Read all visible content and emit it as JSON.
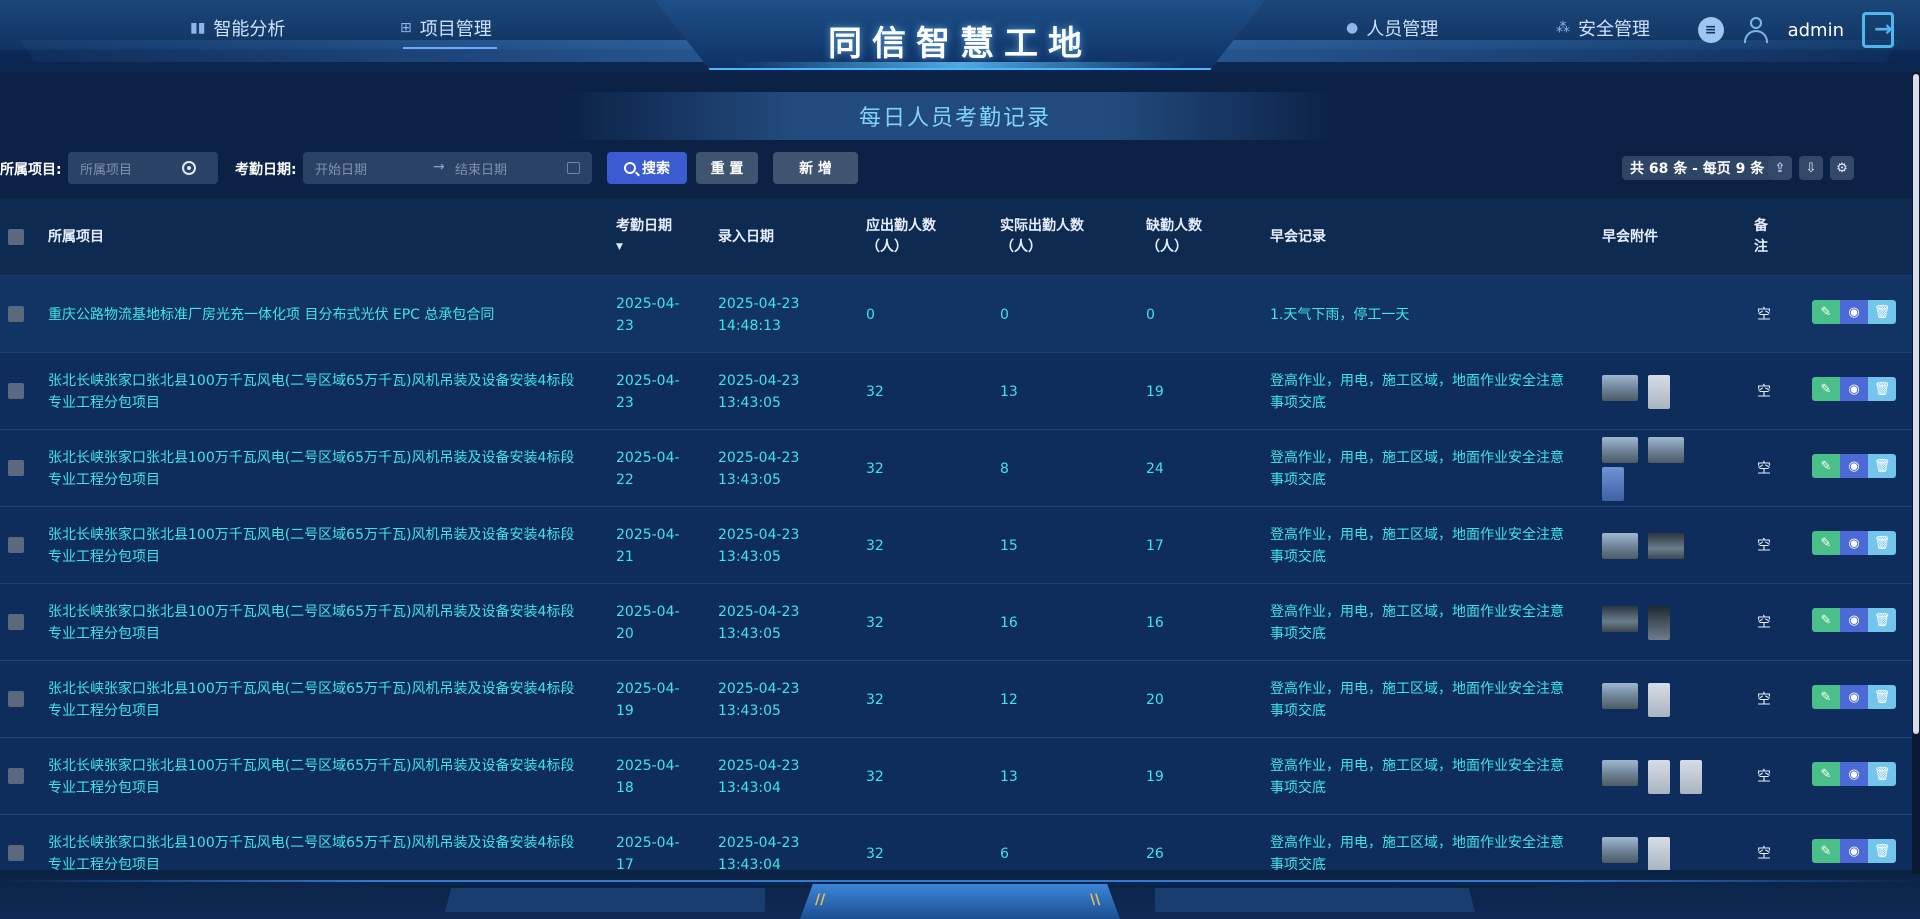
{
  "header": {
    "site_title": "同信智慧工地",
    "nav_left": [
      {
        "label": "智能分析",
        "icon": "bar-chart-icon"
      },
      {
        "label": "项目管理",
        "icon": "grid-icon",
        "active": true
      }
    ],
    "nav_right": [
      {
        "label": "人员管理",
        "icon": "person-icon"
      },
      {
        "label": "安全管理",
        "icon": "safety-icon"
      }
    ],
    "username": "admin"
  },
  "page_title": "每日人员考勤记录",
  "filters": {
    "project_label": "所属项目:",
    "project_placeholder": "所属项目",
    "date_label": "考勤日期:",
    "start_placeholder": "开始日期",
    "date_separator": "→",
    "end_placeholder": "结束日期",
    "search_label": "搜索",
    "reset_label": "重 置",
    "add_label": "新 增",
    "total_text": "共 68 条 - 每页 9 条"
  },
  "table": {
    "columns": {
      "project": "所属项目",
      "att_date": "考勤日期",
      "entry_date": "录入日期",
      "expected": "应出勤人数（人）",
      "actual": "实际出勤人数（人）",
      "absent": "缺勤人数（人）",
      "meeting": "早会记录",
      "attachments": "早会附件",
      "remark": "备注"
    },
    "rows": [
      {
        "project": "重庆公路物流基地标准厂房光充一体化项 目分布式光伏 EPC 总承包合同",
        "att_date": "2025-04-23",
        "entry_date": "2025-04-23 14:48:13",
        "expected": "0",
        "actual": "0",
        "absent": "0",
        "meeting": "1.天气下雨，停工一天",
        "attachments": [],
        "remark": "空"
      },
      {
        "project": "张北长峡张家口张北县100万千瓦风电(二号区域65万千瓦)风机吊装及设备安装4标段专业工程分包项目",
        "att_date": "2025-04-23",
        "entry_date": "2025-04-23 13:43:05",
        "expected": "32",
        "actual": "13",
        "absent": "19",
        "meeting": "登高作业，用电，施工区域，地面作业安全注意事项交底",
        "attachments": [
          "photo",
          "doc"
        ],
        "remark": "空"
      },
      {
        "project": "张北长峡张家口张北县100万千瓦风电(二号区域65万千瓦)风机吊装及设备安装4标段专业工程分包项目",
        "att_date": "2025-04-22",
        "entry_date": "2025-04-23 13:43:05",
        "expected": "32",
        "actual": "8",
        "absent": "24",
        "meeting": "登高作业，用电，施工区域，地面作业安全注意事项交底",
        "attachments": [
          "photo",
          "photo",
          "doc-blue"
        ],
        "remark": "空"
      },
      {
        "project": "张北长峡张家口张北县100万千瓦风电(二号区域65万千瓦)风机吊装及设备安装4标段专业工程分包项目",
        "att_date": "2025-04-21",
        "entry_date": "2025-04-23 13:43:05",
        "expected": "32",
        "actual": "15",
        "absent": "17",
        "meeting": "登高作业，用电，施工区域，地面作业安全注意事项交底",
        "attachments": [
          "photo",
          "photo-dark"
        ],
        "remark": "空"
      },
      {
        "project": "张北长峡张家口张北县100万千瓦风电(二号区域65万千瓦)风机吊装及设备安装4标段专业工程分包项目",
        "att_date": "2025-04-20",
        "entry_date": "2025-04-23 13:43:05",
        "expected": "32",
        "actual": "16",
        "absent": "16",
        "meeting": "登高作业，用电，施工区域，地面作业安全注意事项交底",
        "attachments": [
          "photo-dark",
          "doc-dark"
        ],
        "remark": "空"
      },
      {
        "project": "张北长峡张家口张北县100万千瓦风电(二号区域65万千瓦)风机吊装及设备安装4标段专业工程分包项目",
        "att_date": "2025-04-19",
        "entry_date": "2025-04-23 13:43:05",
        "expected": "32",
        "actual": "12",
        "absent": "20",
        "meeting": "登高作业，用电，施工区域，地面作业安全注意事项交底",
        "attachments": [
          "photo",
          "doc"
        ],
        "remark": "空"
      },
      {
        "project": "张北长峡张家口张北县100万千瓦风电(二号区域65万千瓦)风机吊装及设备安装4标段专业工程分包项目",
        "att_date": "2025-04-18",
        "entry_date": "2025-04-23 13:43:04",
        "expected": "32",
        "actual": "13",
        "absent": "19",
        "meeting": "登高作业，用电，施工区域，地面作业安全注意事项交底",
        "attachments": [
          "photo",
          "doc",
          "doc"
        ],
        "remark": "空"
      },
      {
        "project": "张北长峡张家口张北县100万千瓦风电(二号区域65万千瓦)风机吊装及设备安装4标段专业工程分包项目",
        "att_date": "2025-04-17",
        "entry_date": "2025-04-23 13:43:04",
        "expected": "32",
        "actual": "6",
        "absent": "26",
        "meeting": "登高作业，用电，施工区域，地面作业安全注意事项交底",
        "attachments": [
          "photo",
          "doc"
        ],
        "remark": "空"
      }
    ]
  },
  "colors": {
    "accent_text": "#3ee6e0",
    "search_button": "#3b5bd1",
    "edit_button": "#4bbf8a",
    "view_button": "#4b6ad6",
    "delete_button": "#74c5ec",
    "background": "#0b2146"
  },
  "icons": {
    "action_edit": "edit-icon",
    "action_view": "eye-icon",
    "action_delete": "trash-icon",
    "toolbar": [
      "export-icon",
      "import-icon",
      "settings-icon"
    ]
  }
}
